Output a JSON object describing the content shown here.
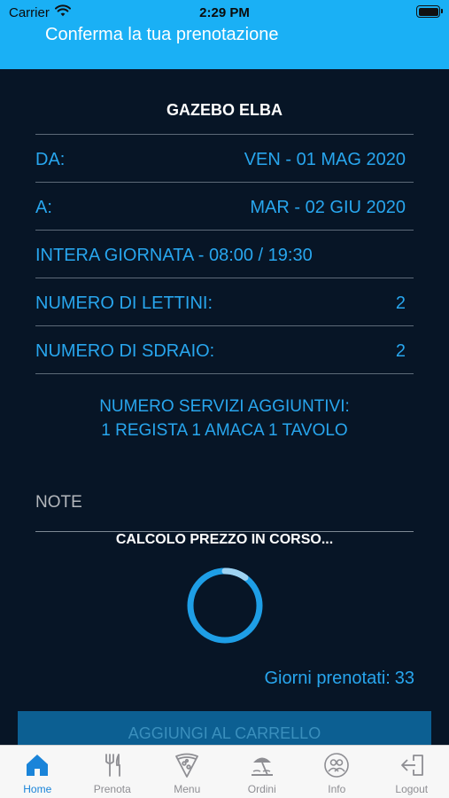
{
  "status_bar": {
    "carrier": "Carrier",
    "time": "2:29 PM"
  },
  "header": {
    "title": "Conferma la tua prenotazione"
  },
  "booking": {
    "venue": "GAZEBO ELBA",
    "from_label": "DA:",
    "from_value": "VEN - 01 MAG 2020",
    "to_label": "A:",
    "to_value": "MAR - 02 GIU 2020",
    "time_slot": "INTERA GIORNATA - 08:00 / 19:30",
    "sunbeds_label": "NUMERO DI LETTINI:",
    "sunbeds_value": "2",
    "deckchairs_label": "NUMERO DI SDRAIO:",
    "deckchairs_value": "2",
    "services_title": "NUMERO SERVIZI AGGIUNTIVI:",
    "services_list": "1 REGISTA 1 AMACA 1 TAVOLO"
  },
  "note": {
    "placeholder": "NOTE",
    "value": ""
  },
  "price": {
    "status": "CALCOLO PREZZO IN CORSO...",
    "spinner_progress": 0.1
  },
  "days": {
    "label": "Giorni prenotati:",
    "value": "33"
  },
  "cart_button": {
    "label": "AGGIUNGI AL CARRELLO"
  },
  "tabs": [
    {
      "label": "Home",
      "icon": "home-icon",
      "active": true
    },
    {
      "label": "Prenota",
      "icon": "cutlery-icon",
      "active": false
    },
    {
      "label": "Menu",
      "icon": "pizza-icon",
      "active": false
    },
    {
      "label": "Ordini",
      "icon": "beach-umbrella-icon",
      "active": false
    },
    {
      "label": "Info",
      "icon": "people-icon",
      "active": false
    },
    {
      "label": "Logout",
      "icon": "logout-icon",
      "active": false
    }
  ],
  "colors": {
    "header": "#1ab0f5",
    "background": "#071526",
    "accent": "#28a6ee",
    "tab_active": "#1a84d9",
    "tab_inactive": "#8e8e93"
  }
}
